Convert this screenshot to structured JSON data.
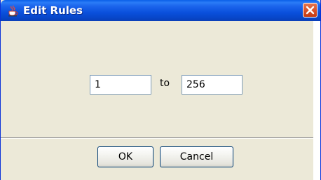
{
  "window": {
    "title": "Edit Rules",
    "title_icon": "java-cup-icon",
    "close_icon": "close-x-icon"
  },
  "range": {
    "from_value": "1",
    "separator_label": "to",
    "to_value": "256"
  },
  "buttons": {
    "ok_label": "OK",
    "cancel_label": "Cancel"
  },
  "colors": {
    "titlebar": "#0a50dc",
    "close_button": "#d8522a",
    "dialog_background": "#ece9d8",
    "field_border": "#7f9db9"
  }
}
